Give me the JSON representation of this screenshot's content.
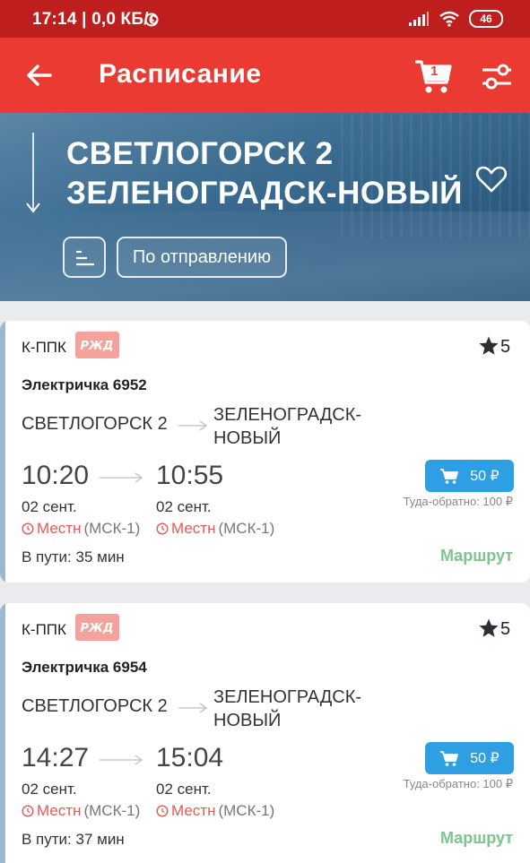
{
  "status_bar": {
    "time": "17:14 | 0,0 КБ/с",
    "battery": "46"
  },
  "app_bar": {
    "title": "Расписание",
    "cart_count": "1"
  },
  "route_header": {
    "from": "СВЕТЛОГОРСК 2",
    "to": "ЗЕЛЕНОГРАДСК-НОВЫЙ",
    "sort_label": "По отправлению"
  },
  "trains": [
    {
      "carrier": "К-ППК",
      "logo_text": "РЖД",
      "rating": "5",
      "name": "Электричка 6952",
      "from": "СВЕТЛОГОРСК 2",
      "to_line1": "ЗЕЛЕНОГРАДСК-",
      "to_line2": "НОВЫЙ",
      "dep_time": "10:20",
      "arr_time": "10:55",
      "dep_date": "02 сент.",
      "arr_date": "02 сент.",
      "tz_local": "Местн",
      "tz_zone": "(МСК-1)",
      "price": "50 ₽",
      "roundtrip": "Туда-обратно: 100 ₽",
      "duration": "В пути: 35 мин",
      "route_label": "Маршрут"
    },
    {
      "carrier": "К-ППК",
      "logo_text": "РЖД",
      "rating": "5",
      "name": "Электричка 6954",
      "from": "СВЕТЛОГОРСК 2",
      "to_line1": "ЗЕЛЕНОГРАДСК-",
      "to_line2": "НОВЫЙ",
      "dep_time": "14:27",
      "arr_time": "15:04",
      "dep_date": "02 сент.",
      "arr_date": "02 сент.",
      "tz_local": "Местн",
      "tz_zone": "(МСК-1)",
      "price": "50 ₽",
      "roundtrip": "Туда-обратно: 100 ₽",
      "duration": "В пути: 37 мин",
      "route_label": "Маршрут"
    }
  ],
  "colors": {
    "app_bar": "#ea3a31",
    "status_bar": "#bf1e1e",
    "buy_button": "#2e9fe3",
    "route_link": "#7dc48e",
    "local_time": "#e35a55"
  }
}
